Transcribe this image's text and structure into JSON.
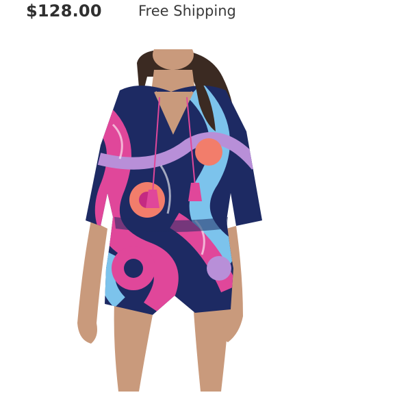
{
  "listing": {
    "price": "$128.00",
    "shipping_label": "Free Shipping"
  },
  "product_image": {
    "subject": "model wearing floral print romper",
    "colors": {
      "skin": "#c99a7c",
      "hair": "#3b2a22",
      "navy": "#1d2a63",
      "pink": "#e0479a",
      "light_blue": "#7cc3ec",
      "coral": "#f27d6b",
      "magenta": "#c42a82",
      "lavender": "#b88fd8"
    }
  }
}
